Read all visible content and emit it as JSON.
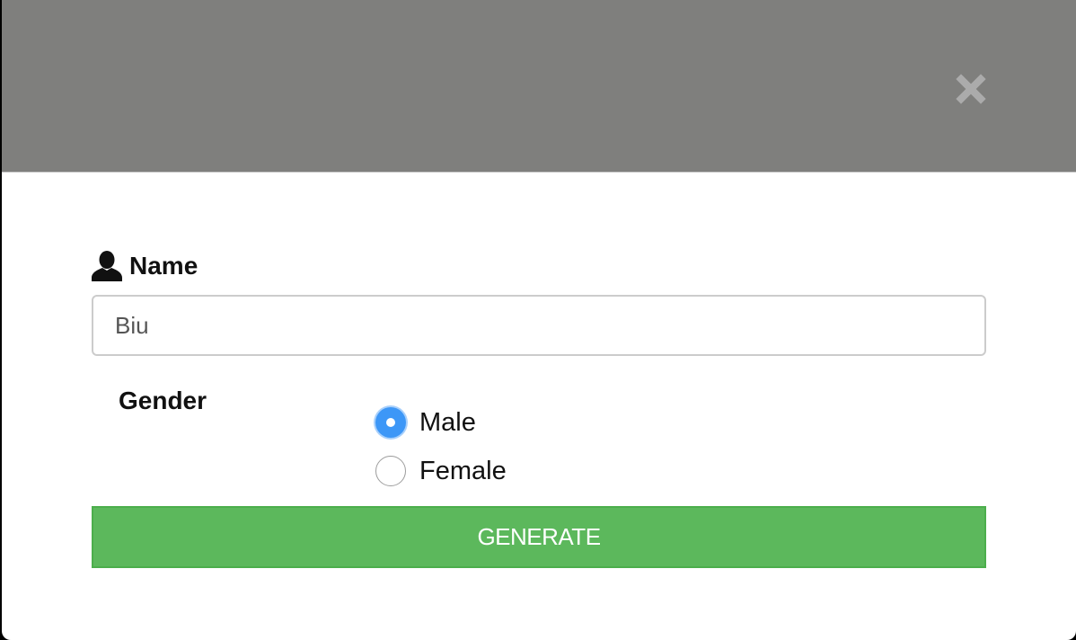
{
  "dialog": {
    "close_icon": "close-icon",
    "header_color": "#7f7f7d"
  },
  "form": {
    "name_label": "Name",
    "name_icon": "user-icon",
    "name_value": "Biu",
    "gender_label": "Gender",
    "gender_options": [
      {
        "label": "Male",
        "selected": true
      },
      {
        "label": "Female",
        "selected": false
      }
    ],
    "generate_label": "GENERATE",
    "accent_color": "#3d97f7",
    "button_color": "#5cb85c"
  }
}
